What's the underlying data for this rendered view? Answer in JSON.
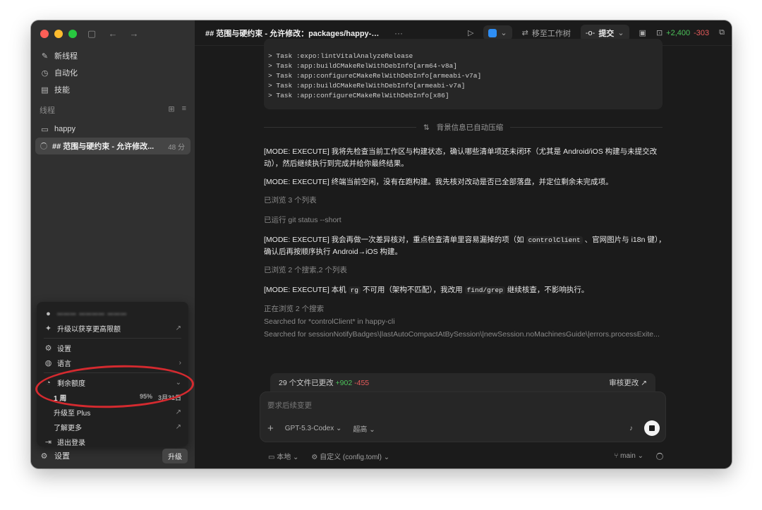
{
  "sidebar": {
    "nav": [
      {
        "icon": "edit-icon",
        "glyph": "✎",
        "label": "新线程"
      },
      {
        "icon": "clock-icon",
        "glyph": "◷",
        "label": "自动化"
      },
      {
        "icon": "skills-icon",
        "glyph": "▤",
        "label": "技能"
      }
    ],
    "section_title": "线程",
    "folder": {
      "icon": "folder-icon",
      "label": "happy"
    },
    "active_thread": {
      "title": "## 范围与硬约束 - 允许修改...",
      "time": "48 分"
    },
    "bottom": {
      "settings_label": "设置",
      "upgrade_label": "升级"
    }
  },
  "account_menu": {
    "account_email": "ꟷꟷꟷ ꟷꟷꟷꟷ ꟷꟷꟷ",
    "upgrade_limit": "升级以获享更高限额",
    "settings": "设置",
    "language": "语言",
    "remaining_quota": "剩余额度",
    "week_label": "1 周",
    "week_percent": "95%",
    "week_reset": "3月31日",
    "upgrade_plus": "升级至 Plus",
    "learn_more": "了解更多",
    "logout": "退出登录"
  },
  "topbar": {
    "title": "## 范围与硬约束 - 允许修改：packages/happy-ap...",
    "move_to_worktree": "移至工作树",
    "commit": "提交",
    "diff_add": "+2,400",
    "diff_del": "-303"
  },
  "code_lines": [
    "> Task :expo:lintVitalAnalyzeRelease",
    "> Task :app:buildCMakeRelWithDebInfo[arm64-v8a]",
    "> Task :app:configureCMakeRelWithDebInfo[armeabi-v7a]",
    "> Task :app:buildCMakeRelWithDebInfo[armeabi-v7a]",
    "> Task :app:configureCMakeRelWithDebInfo[x86]"
  ],
  "compress_notice": "背景信息已自动压缩",
  "messages": {
    "m1": "[MODE: EXECUTE] 我将先检查当前工作区与构建状态，确认哪些清单项还未闭环（尤其是 Android/iOS 构建与未提交改动），然后继续执行到完成并给你最终结果。",
    "m2": "[MODE: EXECUTE] 终端当前空闲，没有在跑构建。我先核对改动是否已全部落盘，并定位剩余未完成项。",
    "s1": "已浏览 3 个列表",
    "s2": "已运行 git status --short",
    "m3a": "[MODE: EXECUTE] 我会再做一次差异核对，重点检查清单里容易漏掉的项（如",
    "m3code": "controlClient",
    "m3b": "、官网图片与 i18n 键），确认后再按顺序执行 Android→iOS 构建。",
    "s3": "已浏览 2 个搜索,2 个列表",
    "m4a": "[MODE: EXECUTE] 本机",
    "m4code1": "rg",
    "m4b": "不可用（架构不匹配），我改用",
    "m4code2": "find/grep",
    "m4c": "继续核查，不影响执行。",
    "s4": "正在浏览 2 个搜索",
    "s5": "Searched for *controlClient* in happy-cli",
    "s6": "Searched for sessionNotifyBadges\\|lastAutoCompactAtBySession\\|newSession.noMachinesGuide\\|errors.processExite..."
  },
  "changes": {
    "label": "29 个文件已更改",
    "add": "+902",
    "del": "-455",
    "review": "审核更改 ↗"
  },
  "composer": {
    "placeholder": "要求后续变更",
    "model": "GPT-5.3-Codex",
    "effort": "超高"
  },
  "statusbar": {
    "local": "本地",
    "config": "自定义 (config.toml)",
    "branch": "main"
  }
}
